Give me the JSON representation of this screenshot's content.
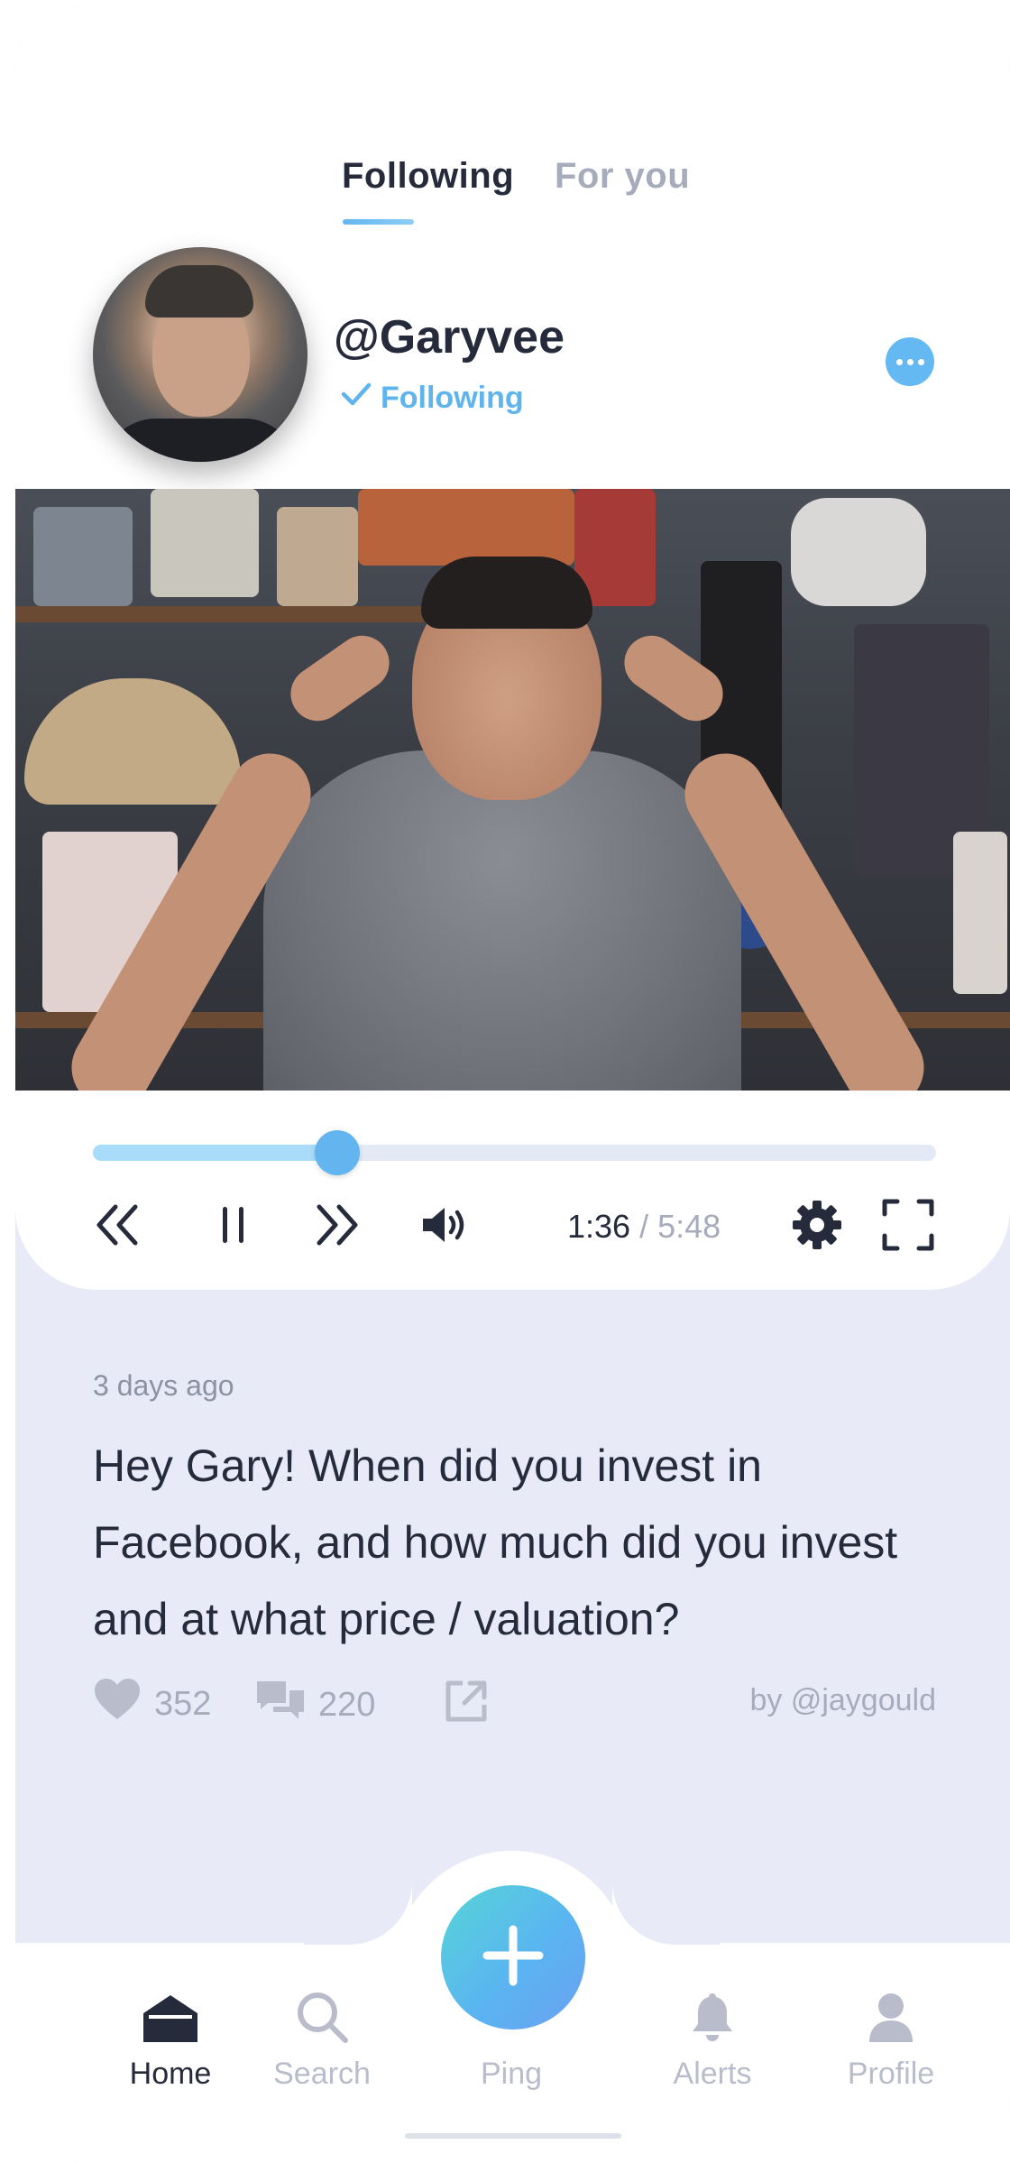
{
  "tabs": {
    "following": "Following",
    "for_you": "For you"
  },
  "profile": {
    "username": "@Garyvee",
    "follow_status": "Following"
  },
  "player": {
    "progress": 0.29,
    "current_time": "1:36",
    "separator": "/",
    "duration": "5:48"
  },
  "post": {
    "time_ago": "3 days ago",
    "text": "Hey Gary! When did you invest in Facebook, and how much did you invest and at what price / valuation?",
    "likes": "352",
    "comments": "220",
    "author": "by @jaygould"
  },
  "nav": {
    "home": "Home",
    "search": "Search",
    "ping": "Ping",
    "alerts": "Alerts",
    "profile": "Profile"
  },
  "colors": {
    "accent": "#5fb4ee",
    "text_dark": "#262b3c",
    "text_muted": "#a7acbd",
    "background": "#e8ebf7"
  }
}
